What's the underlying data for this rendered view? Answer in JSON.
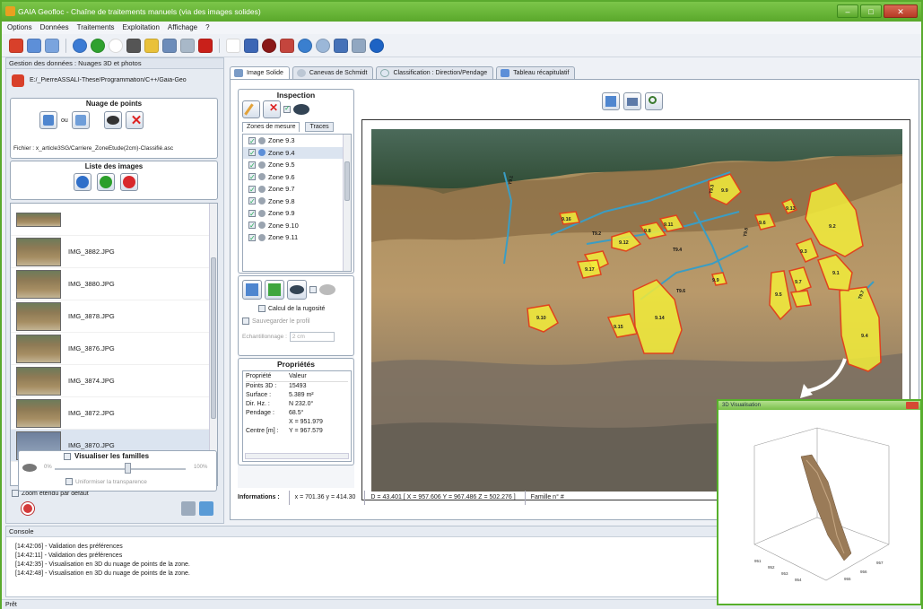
{
  "window": {
    "title": "GAIA Geofloc - Chaîne de traitements manuels (via des images solides)",
    "controls": [
      "–",
      "□",
      "✕"
    ]
  },
  "menu": [
    "Options",
    "Données",
    "Traitements",
    "Exploitation",
    "Affichage",
    "?"
  ],
  "left_panel": {
    "header": "Gestion des données : Nuages 3D et photos",
    "path": "E:/_PierreASSALI-These/Programmation/C++/Gaia-Geo",
    "nuage_title": "Nuage de points",
    "nuage_ou": "ou",
    "fichier": "Fichier : x_article3SG/Carriere_ZoneEtude(2cm)-Classifié.asc",
    "liste_title": "Liste des images",
    "images": [
      "IMG_3882.JPG",
      "IMG_3880.JPG",
      "IMG_3878.JPG",
      "IMG_3876.JPG",
      "IMG_3874.JPG",
      "IMG_3872.JPG",
      "IMG_3870.JPG"
    ],
    "zoom_label": "Zoom étendu par défaut",
    "familles_title": "Visualiser les familles",
    "slider_min": "0%",
    "slider_max": "100%",
    "uniformiser": "Uniformiser la transparence"
  },
  "tabs": [
    "Image Solide",
    "Canevas de Schmidt",
    "Classification : Direction/Pendage",
    "Tableau récapitulatif"
  ],
  "inspection": {
    "title": "Inspection",
    "subtabs": [
      "Zones de mesure",
      "Traces"
    ],
    "zones": [
      "Zone 9.3",
      "Zone 9.4",
      "Zone 9.5",
      "Zone 9.6",
      "Zone 9.7",
      "Zone 9.8",
      "Zone 9.9",
      "Zone 9.10",
      "Zone 9.11"
    ],
    "selected_zone": "Zone 9.4",
    "calcul": "Calcul de la rugosité",
    "sauvegarder": "Sauvegarder le profil",
    "echant_label": "Echantillonnage :",
    "echant_value": "2 cm"
  },
  "proprietes": {
    "title": "Propriétés",
    "col_prop": "Propriété",
    "col_val": "Valeur",
    "rows": [
      {
        "k": "Points 3D :",
        "v": "15493"
      },
      {
        "k": "Surface :",
        "v": "5.389 m²"
      },
      {
        "k": "Dir. Hz. :",
        "v": "N 232.0°"
      },
      {
        "k": "Pendage :",
        "v": "68.5°"
      },
      {
        "k": "",
        "v": "X = 951.979"
      },
      {
        "k": "Centre [m] :",
        "v": "Y = 967.579"
      }
    ]
  },
  "info": {
    "label": "Informations :",
    "xy": "x = 701.36  y = 414.30",
    "d": "D = 43.401  [ X = 957.606  Y = 967.486  Z = 502.276 ]",
    "famille": "Famille n°  #"
  },
  "zone_labels": [
    "9.4",
    "9.13",
    "9.2",
    "9.16",
    "9.12",
    "9.8",
    "9.11",
    "9.6",
    "9.17",
    "9.7",
    "9.5",
    "9.3",
    "9.15",
    "9.1",
    "9.9",
    "9.10",
    "9.14",
    "9.9"
  ],
  "trace_labels": [
    "T9.1",
    "T9.2",
    "T9.3",
    "T9.4",
    "T9.5",
    "T9.6",
    "T9.7"
  ],
  "console": {
    "header": "Console",
    "lines": [
      "[14:42:06] - Validation des préférences",
      "[14:42:11] - Validation des préférences",
      "[14:42:35] - Visualisation en 3D du nuage de points de la zone.",
      "[14:42:48] - Visualisation en 3D du nuage de points de la zone."
    ]
  },
  "status": "Prêt",
  "popup": {
    "title": "3D Visualisation",
    "axis_ticks": [
      "951",
      "952",
      "953",
      "954",
      "955",
      "956",
      "957"
    ]
  },
  "colors": {
    "accent": "#5aaa2e",
    "zone_fill": "#f2ec3a",
    "zone_stroke": "#e0431d",
    "trace": "#3a9dc4"
  }
}
